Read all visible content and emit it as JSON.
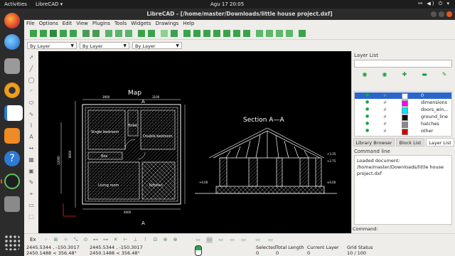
{
  "topbar": {
    "activities": "Activities",
    "app_name": "LibreCAD ▾",
    "clock": "Agu 17  20:05",
    "sys_icons": "⚯ ◀) ⏻ ▾"
  },
  "window": {
    "title": "LibreCAD - [/home/master/Downloads/little house project.dxf]"
  },
  "menu": [
    "File",
    "Options",
    "Edit",
    "View",
    "Plugins",
    "Tools",
    "Widgets",
    "Drawings",
    "Help"
  ],
  "pen_toolbar": {
    "color": "By Layer",
    "width": "By Layer",
    "line_type": "By Layer"
  },
  "drawing": {
    "plan_title": "Map",
    "section_title": "Section A—A",
    "section_marker": "A",
    "rooms": [
      "Single bedroom",
      "Toilet",
      "Double bedroom",
      "Box",
      "Living room",
      "Kitchen"
    ],
    "level_labels": [
      "+3.35",
      "+2.75",
      "+0.00",
      "±0.00"
    ],
    "dim_labels": [
      "3900",
      "3100",
      "8000",
      "12000",
      "4000"
    ]
  },
  "layer_list": {
    "title": "Layer List",
    "layers": [
      {
        "name": "0",
        "color": "#ffffff",
        "selected": true
      },
      {
        "name": "dimensions",
        "color": "#ff00ff"
      },
      {
        "name": "doors_win...",
        "color": "#00e5ff"
      },
      {
        "name": "ground_line",
        "color": "#111111"
      },
      {
        "name": "hatches",
        "color": "#8a8a8a"
      },
      {
        "name": "other",
        "color": "#cc0000"
      }
    ]
  },
  "dock_tabs": [
    "Library Browser",
    "Block List",
    "Layer List"
  ],
  "command": {
    "title": "Command line",
    "output": "Loaded document: /home/master/Downloads/little house project.dxf",
    "prompt": "Command:"
  },
  "snap": {
    "label": "Ex"
  },
  "status": {
    "abs_coord": "2445.5344 , -150.3017",
    "abs_polar": "2450.1488 < 356.48°",
    "rel_coord": "2445.5344 , -150.3017",
    "rel_polar": "2450.1488 < 356.48°",
    "selected_label": "Selected",
    "selected_value": "0",
    "total_length_label": "Total Length",
    "total_length_value": "0",
    "current_layer_label": "Current Layer",
    "current_layer_value": "0",
    "grid_status_label": "Grid Status",
    "grid_status_value": "10 / 100"
  },
  "colors": {
    "accent": "#e95420",
    "canvas": "#000000",
    "green_icon": "#1a9a3a"
  },
  "icons": [
    "firefox-icon",
    "thunderbird-icon",
    "files-icon",
    "rhythmbox-icon",
    "writer-icon",
    "software-icon",
    "help-icon",
    "librecad-icon",
    "trash-icon",
    "apps-grid-icon"
  ]
}
